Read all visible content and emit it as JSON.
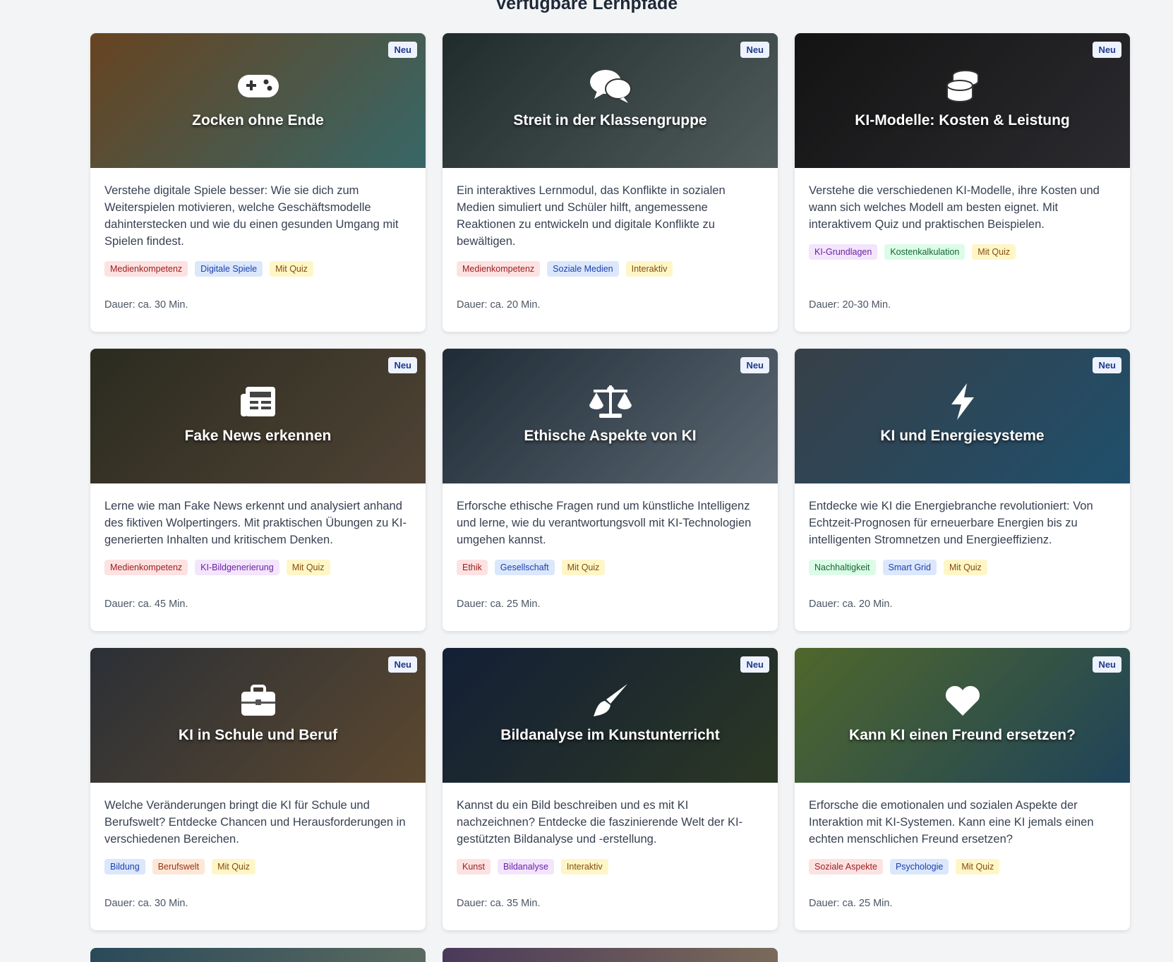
{
  "section_title": "Verfügbare Lernpfade",
  "new_label": "Neu",
  "cards": [
    {
      "title": "Zocken ohne Ende",
      "icon": "gamepad-icon",
      "bg": [
        "#8a5a2b",
        "#4a8a8a"
      ],
      "description": "Verstehe digitale Spiele besser: Wie sie dich zum Weiterspielen motivieren, welche Geschäftsmodelle dahinterstecken und wie du einen gesunden Umgang mit Spielen findest.",
      "tags": [
        {
          "label": "Medienkompetenz",
          "color": "red"
        },
        {
          "label": "Digitale Spiele",
          "color": "blue"
        },
        {
          "label": "Mit Quiz",
          "color": "yellow"
        }
      ],
      "duration": "Dauer: ca. 30 Min."
    },
    {
      "title": "Streit in der Klassengruppe",
      "icon": "chat-bubbles-icon",
      "bg": [
        "#2b3a3a",
        "#6b7a7a"
      ],
      "description": "Ein interaktives Lernmodul, das Konflikte in sozialen Medien simuliert und Schüler hilft, angemessene Reaktionen zu entwickeln und digitale Konflikte zu bewältigen.",
      "tags": [
        {
          "label": "Medienkompetenz",
          "color": "red"
        },
        {
          "label": "Soziale Medien",
          "color": "blue"
        },
        {
          "label": "Interaktiv",
          "color": "yellow"
        }
      ],
      "duration": "Dauer: ca. 20 Min."
    },
    {
      "title": "KI-Modelle: Kosten & Leistung",
      "icon": "coins-icon",
      "bg": [
        "#1a1a1a",
        "#3a3a40"
      ],
      "description": "Verstehe die verschiedenen KI-Modelle, ihre Kosten und wann sich welches Modell am besten eignet. Mit interaktivem Quiz und praktischen Beispielen.",
      "tags": [
        {
          "label": "KI-Grundlagen",
          "color": "purple"
        },
        {
          "label": "Kostenkalkulation",
          "color": "green"
        },
        {
          "label": "Mit Quiz",
          "color": "yellow"
        }
      ],
      "duration": "Dauer: 20-30 Min."
    },
    {
      "title": "Fake News erkennen",
      "icon": "newspaper-icon",
      "bg": [
        "#3a3a2a",
        "#6a5a48"
      ],
      "description": "Lerne wie man Fake News erkennt und analysiert anhand des fiktiven Wolpertingers. Mit praktischen Übungen zu KI-generierten Inhalten und kritischem Denken.",
      "tags": [
        {
          "label": "Medienkompetenz",
          "color": "red"
        },
        {
          "label": "KI-Bildgenerierung",
          "color": "purple"
        },
        {
          "label": "Mit Quiz",
          "color": "yellow"
        }
      ],
      "duration": "Dauer: ca. 45 Min."
    },
    {
      "title": "Ethische Aspekte von KI",
      "icon": "scales-icon",
      "bg": [
        "#2a3a48",
        "#7a8a98"
      ],
      "description": "Erforsche ethische Fragen rund um künstliche Intelligenz und lerne, wie du verantwortungsvoll mit KI-Technologien umgehen kannst.",
      "tags": [
        {
          "label": "Ethik",
          "color": "red"
        },
        {
          "label": "Gesellschaft",
          "color": "blue"
        },
        {
          "label": "Mit Quiz",
          "color": "yellow"
        }
      ],
      "duration": "Dauer: ca. 25 Min."
    },
    {
      "title": "KI und Energiesysteme",
      "icon": "lightning-icon",
      "bg": [
        "#4a5560",
        "#2a6a90"
      ],
      "description": "Entdecke wie KI die Energiebranche revolutioniert: Von Echtzeit-Prognosen für erneuerbare Energien bis zu intelligenten Stromnetzen und Energieeffizienz.",
      "tags": [
        {
          "label": "Nachhaltigkeit",
          "color": "green"
        },
        {
          "label": "Smart Grid",
          "color": "blue"
        },
        {
          "label": "Mit Quiz",
          "color": "yellow"
        }
      ],
      "duration": "Dauer: ca. 20 Min."
    },
    {
      "title": "KI in Schule und Beruf",
      "icon": "briefcase-icon",
      "bg": [
        "#3a4048",
        "#7a6040"
      ],
      "description": "Welche Veränderungen bringt die KI für Schule und Berufswelt? Entdecke Chancen und Herausforderungen in verschiedenen Bereichen.",
      "tags": [
        {
          "label": "Bildung",
          "color": "blue"
        },
        {
          "label": "Berufswelt",
          "color": "orange"
        },
        {
          "label": "Mit Quiz",
          "color": "yellow"
        }
      ],
      "duration": "Dauer: ca. 30 Min."
    },
    {
      "title": "Bildanalyse im Kunstunterricht",
      "icon": "paintbrush-icon",
      "bg": [
        "#1a2a48",
        "#3a4a30"
      ],
      "description": "Kannst du ein Bild beschreiben und es mit KI nachzeichnen? Entdecke die faszinierende Welt der KI-gestützten Bildanalyse und -erstellung.",
      "tags": [
        {
          "label": "Kunst",
          "color": "red"
        },
        {
          "label": "Bildanalyse",
          "color": "purple"
        },
        {
          "label": "Interaktiv",
          "color": "yellow"
        }
      ],
      "duration": "Dauer: ca. 35 Min."
    },
    {
      "title": "Kann KI einen Freund ersetzen?",
      "icon": "heart-icon",
      "bg": [
        "#6a8a3a",
        "#2a5a78"
      ],
      "description": "Erforsche die emotionalen und sozialen Aspekte der Interaktion mit KI-Systemen. Kann eine KI jemals einen echten menschlichen Freund ersetzen?",
      "tags": [
        {
          "label": "Soziale Aspekte",
          "color": "red"
        },
        {
          "label": "Psychologie",
          "color": "blue"
        },
        {
          "label": "Mit Quiz",
          "color": "yellow"
        }
      ],
      "duration": "Dauer: ca. 25 Min."
    }
  ]
}
